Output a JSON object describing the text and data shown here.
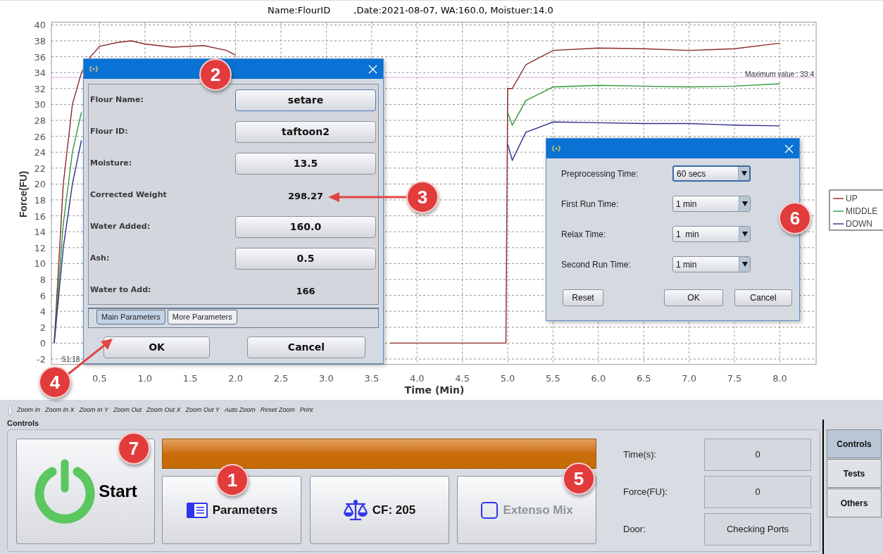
{
  "chart": {
    "title": "Name:FlourID        ,Date:2021-08-07, WA:160.0, Moistuer:14.0",
    "chart_data": {
      "type": "line",
      "xlabel": "Time (Min)",
      "ylabel": "Force(FU)",
      "x": [
        0,
        0.1,
        0.2,
        0.3,
        0.4,
        0.5,
        0.7,
        0.85,
        1.0,
        1.3,
        1.65,
        1.9,
        2.0,
        2.02,
        3.7,
        4.98,
        5.0,
        5.05,
        5.2,
        5.5,
        6.0,
        6.5,
        7.0,
        7.5,
        8.0
      ],
      "series": [
        {
          "name": "UP",
          "color": "#8b2a2a",
          "values": [
            0,
            20,
            30,
            34,
            36,
            37.3,
            37.8,
            38,
            37.6,
            37.2,
            37.4,
            36.8,
            36.2,
            null,
            0,
            0,
            32,
            32,
            35,
            36.8,
            37.1,
            37,
            36.8,
            37,
            37.7
          ]
        },
        {
          "name": "MIDDLE",
          "color": "#2f9a3a",
          "values": [
            0,
            15,
            24,
            29,
            null,
            null,
            null,
            null,
            null,
            null,
            null,
            null,
            null,
            null,
            null,
            null,
            29,
            27.4,
            30.5,
            32.2,
            32.4,
            32.3,
            32.2,
            32.3,
            32.6
          ]
        },
        {
          "name": "DOWN",
          "color": "#2c2f8f",
          "values": [
            0,
            12,
            20,
            25.5,
            null,
            null,
            null,
            null,
            null,
            null,
            null,
            null,
            null,
            null,
            null,
            null,
            25,
            23,
            26.5,
            27.8,
            27.7,
            27.6,
            27.6,
            27.4,
            27.3
          ]
        }
      ],
      "xlim": [
        0,
        8.4
      ],
      "ylim": [
        -2.5,
        40
      ],
      "xticks": [
        {
          "value": 0.5,
          "label": "0.5"
        },
        {
          "value": 1,
          "label": "1.0"
        },
        {
          "value": 1.5,
          "label": "1.5"
        },
        {
          "value": 2,
          "label": "2.0"
        },
        {
          "value": 2.5,
          "label": "2.5"
        },
        {
          "value": 3,
          "label": "3.0"
        },
        {
          "value": 3.5,
          "label": "3.5"
        },
        {
          "value": 4,
          "label": "4.0"
        },
        {
          "value": 4.5,
          "label": "4.5"
        },
        {
          "value": 5,
          "label": "5.0"
        },
        {
          "value": 5.5,
          "label": "5.5"
        },
        {
          "value": 6,
          "label": "6.0"
        },
        {
          "value": 6.5,
          "label": "6.5"
        },
        {
          "value": 7,
          "label": "7.0"
        },
        {
          "value": 7.5,
          "label": "7.5"
        },
        {
          "value": 8,
          "label": "8.0"
        }
      ],
      "yticks": [
        -2,
        0,
        2,
        4,
        6,
        8,
        10,
        12,
        14,
        16,
        18,
        20,
        22,
        24,
        26,
        28,
        30,
        32,
        34,
        36,
        38,
        40
      ],
      "grid": true,
      "legend": true,
      "ref_lines": [
        {
          "axis": "y",
          "value": 33.4,
          "label": "Maximum value : 33.4"
        }
      ],
      "annotations": [
        "S1:18"
      ]
    }
  },
  "parameters_dialog": {
    "fields": [
      {
        "label": "Flour Name:",
        "value": "setare",
        "kind": "button",
        "focused": true
      },
      {
        "label": "Flour ID:",
        "value": "taftoon2",
        "kind": "button",
        "focused": false
      },
      {
        "label": "Moisture:",
        "value": "13.5",
        "kind": "button",
        "focused": false
      },
      {
        "label": "Corrected Weight",
        "value": "298.27",
        "kind": "text"
      },
      {
        "label": "Water Added:",
        "value": "160.0",
        "kind": "button",
        "focused": false
      },
      {
        "label": "Ash:",
        "value": "0.5",
        "kind": "button",
        "focused": false
      },
      {
        "label": "Water to Add:",
        "value": "166",
        "kind": "text"
      }
    ],
    "tabs": [
      {
        "label": "Main Parameters",
        "selected": true
      },
      {
        "label": "More Parameters",
        "selected": false
      }
    ],
    "buttons": [
      "OK",
      "Cancel"
    ]
  },
  "timing_dialog": {
    "fields": [
      {
        "label": "Preprocessing Time:",
        "value": "60 secs",
        "focused": true
      },
      {
        "label": "First Run Time:",
        "value": "1 min",
        "focused": false
      },
      {
        "label": "Relax Time:",
        "value": "1  min",
        "focused": false
      },
      {
        "label": "Second Run Time:",
        "value": "1 min",
        "focused": false
      }
    ],
    "buttons": [
      "Reset",
      "OK",
      "Cancel"
    ]
  },
  "callouts": [
    "2",
    "3",
    "6",
    "4",
    "7",
    "1",
    "5"
  ],
  "zoom_toolbar": [
    "Zoom In",
    "Zoom In X",
    "Zoom In Y",
    "Zoom Out",
    "Zoom Out X",
    "Zoom Out Y",
    "Auto Zoom",
    "Reset Zoom",
    "Print"
  ],
  "controls": {
    "title": "Controls",
    "start": "Start",
    "progress": {
      "level": 1
    },
    "buttons": [
      {
        "label": "Parameters",
        "kind": "parameters",
        "disabled": false
      },
      {
        "label": "CF: 205",
        "kind": "calibration",
        "disabled": false
      },
      {
        "label": "Extenso Mix",
        "kind": "checkbox",
        "disabled": true
      }
    ],
    "readouts": [
      {
        "label": "Time(s):",
        "value": "0"
      },
      {
        "label": "Force(FU):",
        "value": "0"
      },
      {
        "label": "Door:",
        "value": "Checking Ports"
      }
    ]
  },
  "side_tabs": [
    {
      "label": "Controls",
      "selected": true
    },
    {
      "label": "Tests",
      "selected": false
    },
    {
      "label": "Others",
      "selected": false
    }
  ]
}
